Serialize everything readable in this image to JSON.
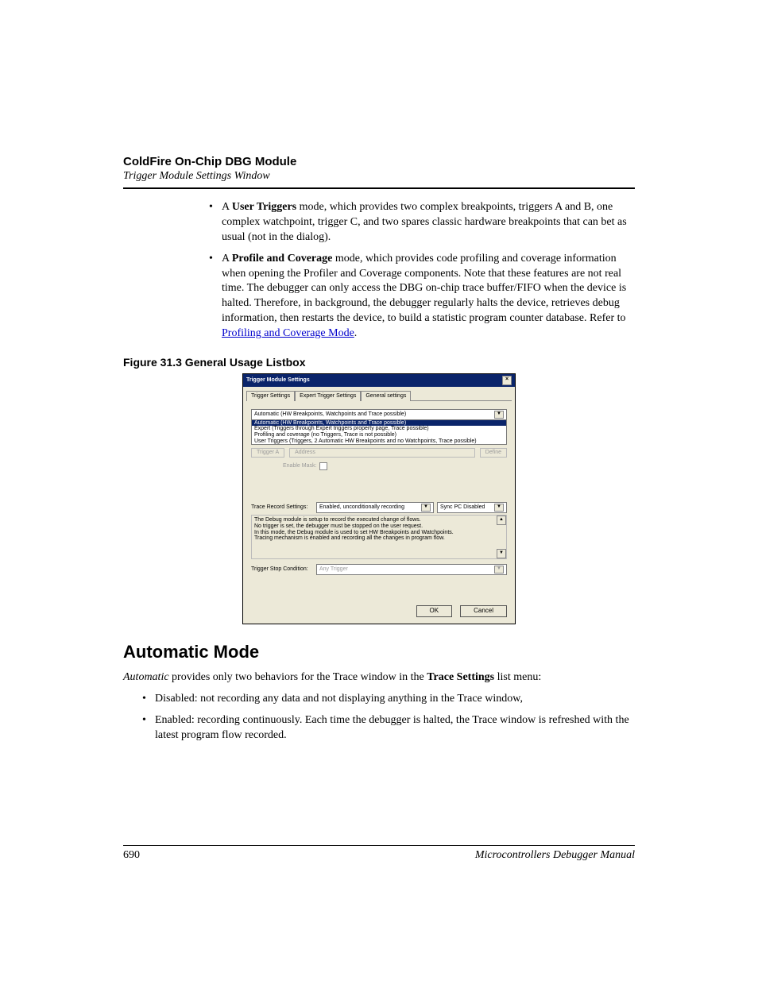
{
  "header": {
    "title": "ColdFire On-Chip DBG Module",
    "subtitle": "Trigger Module Settings Window"
  },
  "bullets_top": [
    {
      "lead": "A ",
      "bold": "User Triggers",
      "rest": " mode, which provides two complex breakpoints, triggers A and B, one complex watchpoint, trigger C, and two spares classic hardware breakpoints that can bet as usual (not in the dialog)."
    },
    {
      "lead": "A ",
      "bold": "Profile and Coverage",
      "rest_pre_link": " mode, which provides code profiling and coverage information when opening the Profiler and Coverage components. Note that these features are not real time. The debugger can only access the DBG on-chip trace buffer/FIFO when the device is halted. Therefore, in background, the debugger regularly halts the device, retrieves debug information, then restarts the device, to build a statistic program counter database. Refer to ",
      "link_text": "Profiling and Coverage Mode",
      "rest_post_link": "."
    }
  ],
  "figure_caption": "Figure 31.3  General Usage Listbox",
  "dialog": {
    "title": "Trigger Module Settings",
    "close_glyph": "×",
    "tabs": [
      "Trigger Settings",
      "Expert Trigger Settings",
      "General settings"
    ],
    "active_tab_index": 0,
    "mode_combo_value": "Automatic (HW Breakpoints, Watchpoints and Trace possible)",
    "mode_options": [
      "Automatic (HW Breakpoints, Watchpoints and Trace possible)",
      "Expert (Triggers through Expert triggers property page, Trace possible)",
      "Profiling and coverage (no Triggers, Trace is not possible)",
      "User Triggers (Triggers, 2 Automatic HW Breakpoints and no Watchpoints, Trace possible)"
    ],
    "selected_option_index": 0,
    "ghost_buttons": [
      "Trigger A",
      "Address",
      "Define"
    ],
    "enable_mask_label": "Enable Mask:",
    "trace_record_label": "Trace Record Settings:",
    "trace_record_value": "Enabled, unconditionally recording",
    "sync_value": "Sync PC Disabled",
    "desc_lines": [
      "The Debug module is setup to record the executed change of flows.",
      "No trigger is set, the debugger must be stopped on the user request.",
      "In this mode, the Debug module is used to set HW Breakpoints and Watchpoints.",
      "Tracing mechanism is enabled and recording all the changes in program flow."
    ],
    "stop_cond_label": "Trigger Stop Condition:",
    "stop_cond_value": "Any Trigger",
    "buttons": {
      "ok": "OK",
      "cancel": "Cancel"
    }
  },
  "section": {
    "title": "Automatic Mode",
    "para_lead_italic": "Automatic",
    "para_middle": " provides only two behaviors for the Trace window in the ",
    "para_bold": "Trace Settings",
    "para_end": " list menu:",
    "bullets": [
      "Disabled: not recording any data and not displaying anything in the Trace window,",
      "Enabled: recording continuously. Each time the debugger is halted, the Trace window is refreshed with the latest program flow recorded."
    ]
  },
  "footer": {
    "page": "690",
    "manual": "Microcontrollers Debugger Manual"
  }
}
